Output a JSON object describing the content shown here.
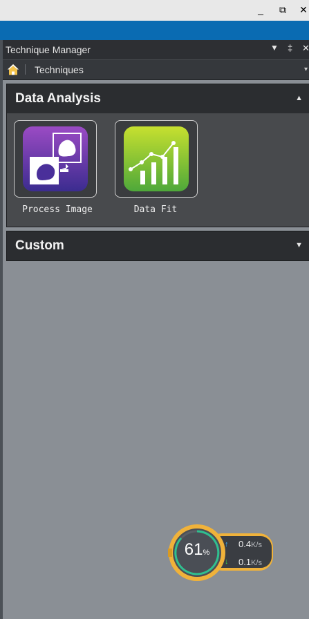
{
  "window": {
    "minimize_glyph": "_",
    "restore_glyph": "⧉",
    "close_glyph": "✕"
  },
  "panel": {
    "title": "Technique Manager",
    "dropdown_glyph": "▼",
    "pin_glyph": "‡",
    "close_glyph": "✕"
  },
  "breadcrumb": {
    "home_icon": "home-icon",
    "label": "Techniques",
    "dropdown_glyph": "▾"
  },
  "sections": {
    "data_analysis": {
      "title": "Data Analysis",
      "caret": "▲"
    },
    "custom": {
      "title": "Custom",
      "caret": "▼"
    }
  },
  "tiles": [
    {
      "label": "Process Image",
      "icon": "process-image-icon",
      "color": "#6a2fa3"
    },
    {
      "label": "Data Fit",
      "icon": "data-fit-icon",
      "color": "#7cc22a"
    }
  ],
  "network_widget": {
    "percent": "61",
    "percent_sign": "%",
    "upload": "0.4",
    "upload_unit": "K/s",
    "download": "0.1",
    "download_unit": "K/s",
    "accent_color": "#f0b23a"
  }
}
